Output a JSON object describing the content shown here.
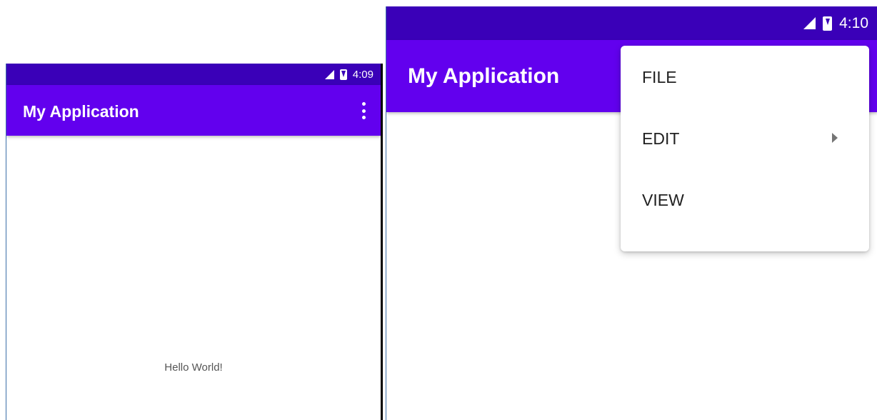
{
  "left_screen": {
    "status_bar": {
      "time": "4:09",
      "signal_icon": "cellular-signal-icon",
      "battery_icon": "battery-charging-icon"
    },
    "app_bar": {
      "title": "My Application",
      "overflow_icon": "more-vertical-icon"
    },
    "content": {
      "text": "Hello World!"
    }
  },
  "right_screen": {
    "status_bar": {
      "time": "4:10",
      "signal_icon": "cellular-signal-icon",
      "battery_icon": "battery-charging-icon"
    },
    "app_bar": {
      "title": "My Application"
    },
    "overflow_menu": {
      "items": [
        {
          "label": "FILE",
          "has_submenu": false
        },
        {
          "label": "EDIT",
          "has_submenu": true
        },
        {
          "label": "VIEW",
          "has_submenu": false
        }
      ]
    }
  },
  "colors": {
    "status_bar": "#3a00b8",
    "app_bar": "#6200ee",
    "background": "#ffffff",
    "menu_text": "#212121",
    "body_text": "#555555"
  }
}
